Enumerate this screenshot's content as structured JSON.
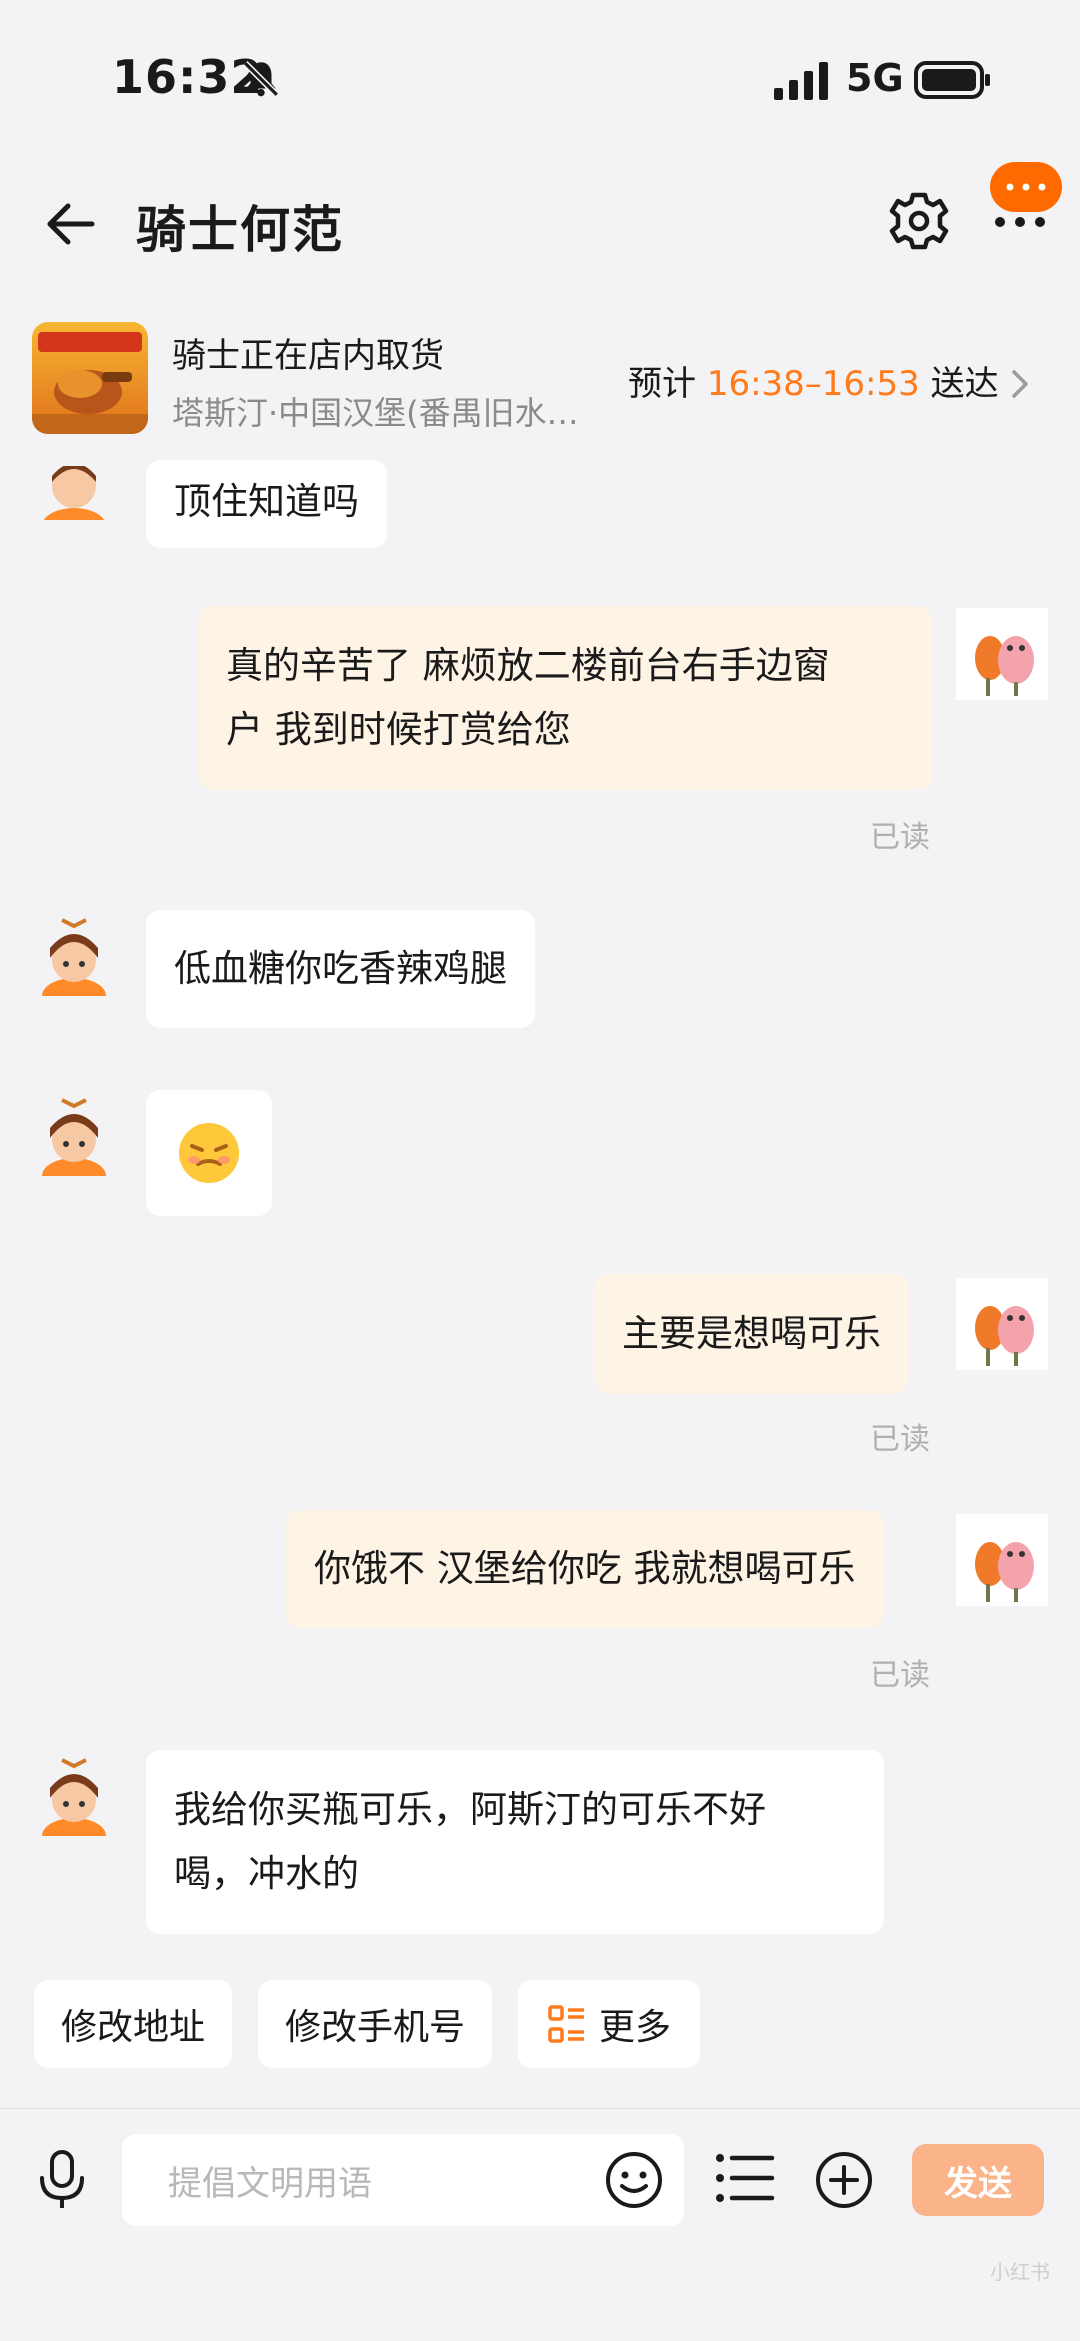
{
  "status_bar": {
    "time": "16:32",
    "network": "5G"
  },
  "header": {
    "title": "骑士何范"
  },
  "order": {
    "status": "骑士正在店内取货",
    "store": "塔斯汀·中国汉堡(番禺旧水…",
    "eta_prefix": "预计",
    "eta_time": "16:38–16:53",
    "eta_suffix": "送达"
  },
  "messages": [
    {
      "side": "left",
      "lines": [
        "顶住知道吗"
      ]
    },
    {
      "side": "right",
      "lines": [
        "真的辛苦了 麻烦放二楼前台右手边窗",
        "户 我到时候打赏给您"
      ],
      "read": "已读"
    },
    {
      "side": "left",
      "lines": [
        "低血糖你吃香辣鸡腿"
      ]
    },
    {
      "side": "left",
      "emoji": "sticker"
    },
    {
      "side": "right",
      "lines": [
        "主要是想喝可乐"
      ],
      "read": "已读"
    },
    {
      "side": "right",
      "lines": [
        "你饿不 汉堡给你吃 我就想喝可乐"
      ],
      "read": "已读"
    },
    {
      "side": "left",
      "lines": [
        "我给你买瓶可乐，阿斯汀的可乐不好",
        "喝，冲水的"
      ]
    }
  ],
  "quick_actions": [
    "修改地址",
    "修改手机号",
    "更多"
  ],
  "input": {
    "placeholder": "提倡文明用语",
    "send_label": "发送"
  },
  "watermark": "小红书",
  "colors": {
    "accent": "#ff7a1a",
    "send_bg": "#fbb48a",
    "right_bubble": "#fdf4e6"
  }
}
